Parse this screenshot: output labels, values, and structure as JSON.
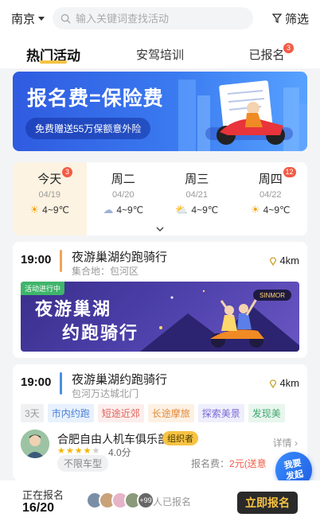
{
  "header": {
    "city": "南京",
    "search_placeholder": "输入关键词查找活动",
    "filter_label": "筛选"
  },
  "tabs": [
    {
      "label": "热门活动",
      "active": true
    },
    {
      "label": "安驾培训",
      "active": false
    },
    {
      "label": "已报名",
      "badge": "3"
    }
  ],
  "banner": {
    "title": "报名费=保险费",
    "subtitle": "免费赠送55万保额意外险"
  },
  "week": {
    "days": [
      {
        "name": "今天",
        "date": "04/19",
        "weather_icon": "sun-icon",
        "temp": "4~9℃",
        "badge": "3"
      },
      {
        "name": "周二",
        "date": "04/20",
        "weather_icon": "cloud-icon",
        "temp": "4~9℃"
      },
      {
        "name": "周三",
        "date": "04/21",
        "weather_icon": "partly-cloudy-icon",
        "temp": "4~9℃"
      },
      {
        "name": "周四",
        "date": "04/22",
        "weather_icon": "sun-icon",
        "temp": "4~9℃",
        "badge": "12"
      }
    ]
  },
  "events": [
    {
      "time": "19:00",
      "title": "夜游巢湖约跑骑行",
      "location": "集合地：包河区",
      "distance": "4km",
      "accent": "#f0a45a",
      "poster_status": "活动进行中",
      "poster_line1": "夜游巢湖",
      "poster_line2": "约跑骑行"
    },
    {
      "time": "19:00",
      "title": "夜游巢湖约跑骑行",
      "location": "包河万达城北门",
      "distance": "4km",
      "accent": "#4a90e2",
      "tags": [
        "3天",
        "市内约跑",
        "短途近郊",
        "长途摩旅",
        "探索美景",
        "发现美"
      ],
      "organizer": "合肥自由人机车俱乐部",
      "organizer_badge": "组织者",
      "rating": "4.0分",
      "stars": 4,
      "detail_label": "详情",
      "car_tag": "不限车型",
      "fee_label": "报名费：",
      "fee_value": "2元(送意"
    }
  ],
  "bottom": {
    "status_label": "正在报名",
    "count": "16/20",
    "more_avatars": "+99",
    "joined_label": "人已报名",
    "signup_label": "立即报名"
  },
  "fab_label_1": "我要",
  "fab_label_2": "发起"
}
